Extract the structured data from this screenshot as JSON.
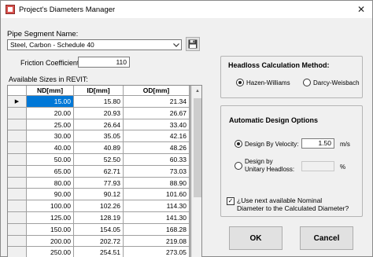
{
  "window": {
    "title": "Project's Diameters Manager",
    "close_glyph": "✕"
  },
  "pipe_segment": {
    "label": "Pipe Segment Name:",
    "selected": "Steel, Carbon - Schedule 40"
  },
  "friction": {
    "label": "Friction Coefficient:",
    "value": "110"
  },
  "sizes_grid": {
    "label": "Available Sizes in REVIT:",
    "columns": [
      "ND[mm]",
      "ID[mm]",
      "OD[mm]"
    ],
    "current_row_marker": "▶",
    "rows": [
      [
        "15.00",
        "15.80",
        "21.34"
      ],
      [
        "20.00",
        "20.93",
        "26.67"
      ],
      [
        "25.00",
        "26.64",
        "33.40"
      ],
      [
        "30.00",
        "35.05",
        "42.16"
      ],
      [
        "40.00",
        "40.89",
        "48.26"
      ],
      [
        "50.00",
        "52.50",
        "60.33"
      ],
      [
        "65.00",
        "62.71",
        "73.03"
      ],
      [
        "80.00",
        "77.93",
        "88.90"
      ],
      [
        "90.00",
        "90.12",
        "101.60"
      ],
      [
        "100.00",
        "102.26",
        "114.30"
      ],
      [
        "125.00",
        "128.19",
        "141.30"
      ],
      [
        "150.00",
        "154.05",
        "168.28"
      ],
      [
        "200.00",
        "202.72",
        "219.08"
      ],
      [
        "250.00",
        "254.51",
        "273.05"
      ]
    ]
  },
  "headloss": {
    "title": "Headloss Calculation Method:",
    "options": [
      "Hazen-Williams",
      "Darcy-Weisbach"
    ],
    "selected_index": 0
  },
  "design": {
    "title": "Automatic Design Options",
    "velocity_label": "Design By Velocity:",
    "velocity_value": "1.50",
    "velocity_unit": "m/s",
    "headloss_label_line1": "Design  by",
    "headloss_label_line2": "Unitary Headloss:",
    "headloss_unit": "%",
    "nominal_line1": "¿Use next available Nominal",
    "nominal_line2": "Diameter to the Calculated Diameter?",
    "nominal_checked": true
  },
  "buttons": {
    "ok": "OK",
    "cancel": "Cancel"
  },
  "icons": {
    "app": "app-icon",
    "save": "floppy-disk-icon",
    "dropdown": "chevron-down-icon"
  }
}
